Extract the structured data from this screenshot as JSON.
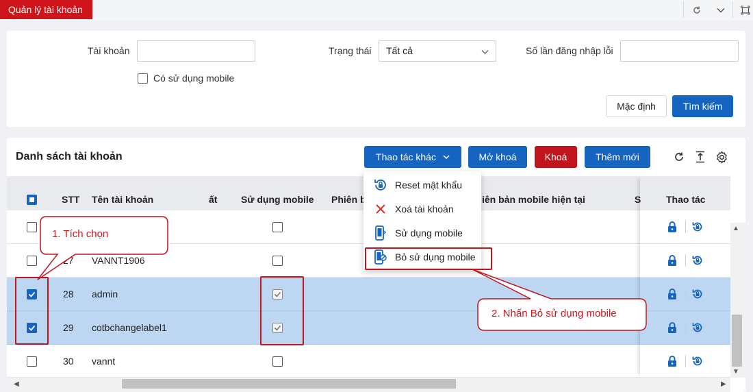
{
  "window": {
    "title": "Quản lý tài khoản"
  },
  "search": {
    "account_label": "Tài khoản",
    "account_value": "",
    "status_label": "Trạng thái",
    "status_value": "Tất cả",
    "login_fail_label": "Số lần đăng nhập lỗi",
    "login_fail_value": "",
    "mobile_checkbox_label": "Có sử dụng mobile",
    "default_button": "Mặc định",
    "search_button": "Tìm kiếm"
  },
  "list": {
    "title": "Danh sách tài khoản",
    "more_actions_button": "Thao tác khác",
    "unlock_button": "Mở khoá",
    "lock_button": "Khoá",
    "add_button": "Thêm mới",
    "columns": {
      "stt": "STT",
      "account_name": "Tên tài khoản",
      "partial": "ất",
      "use_mobile": "Sử dụng mobile",
      "version": "Phiên b",
      "current_mobile_version": "iên bản mobile hiện tại",
      "partial_s": "S",
      "actions": "Thao tác"
    },
    "rows": [
      {
        "stt": "",
        "name": "",
        "checked": false,
        "mobile": false
      },
      {
        "stt": "27",
        "name": "VANNT1906",
        "checked": false,
        "mobile": false
      },
      {
        "stt": "28",
        "name": "admin",
        "checked": true,
        "mobile": true
      },
      {
        "stt": "29",
        "name": "cotbchangelabel1",
        "checked": true,
        "mobile": true
      },
      {
        "stt": "30",
        "name": "vannt",
        "checked": false,
        "mobile": false
      }
    ]
  },
  "menu": {
    "items": [
      {
        "label": "Reset mật khẩu",
        "icon": "lock-reset-icon"
      },
      {
        "label": "Xoá tài khoản",
        "icon": "close-icon"
      },
      {
        "label": "Sử dụng mobile",
        "icon": "mobile-icon"
      },
      {
        "label": "Bỏ sử dụng mobile",
        "icon": "mobile-off-icon"
      }
    ]
  },
  "annotations": {
    "step1": "1. Tích chọn",
    "step2": "2. Nhấn Bỏ sử dụng mobile"
  },
  "colors": {
    "primary": "#1565c0",
    "danger": "#c0151c",
    "selected_row": "#bdd7f3",
    "annotation_red": "#d0141b"
  }
}
